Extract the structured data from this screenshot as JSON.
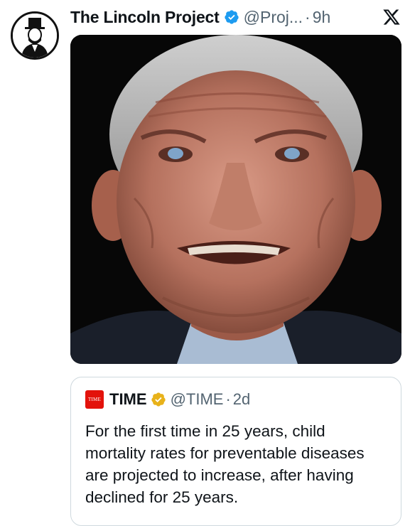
{
  "tweet": {
    "display_name": "The Lincoln Project",
    "handle": "@Proj...",
    "separator": "·",
    "time": "9h",
    "verified_color": "#1d9bf0"
  },
  "media": {
    "icon": "photo"
  },
  "quoted_tweet": {
    "account_name": "TIME",
    "logo_text": "TIME",
    "handle": "@TIME",
    "separator": "·",
    "time": "2d",
    "text": "For the first time in 25 years, child mortality rates for preventable diseases are projected to increase, after having declined for 25 years.",
    "verified_color": "#e8b21a",
    "logo_color": "#e3120b"
  },
  "colors": {
    "text": "#0f1419",
    "secondary": "#536471",
    "border": "#cfd9de"
  }
}
